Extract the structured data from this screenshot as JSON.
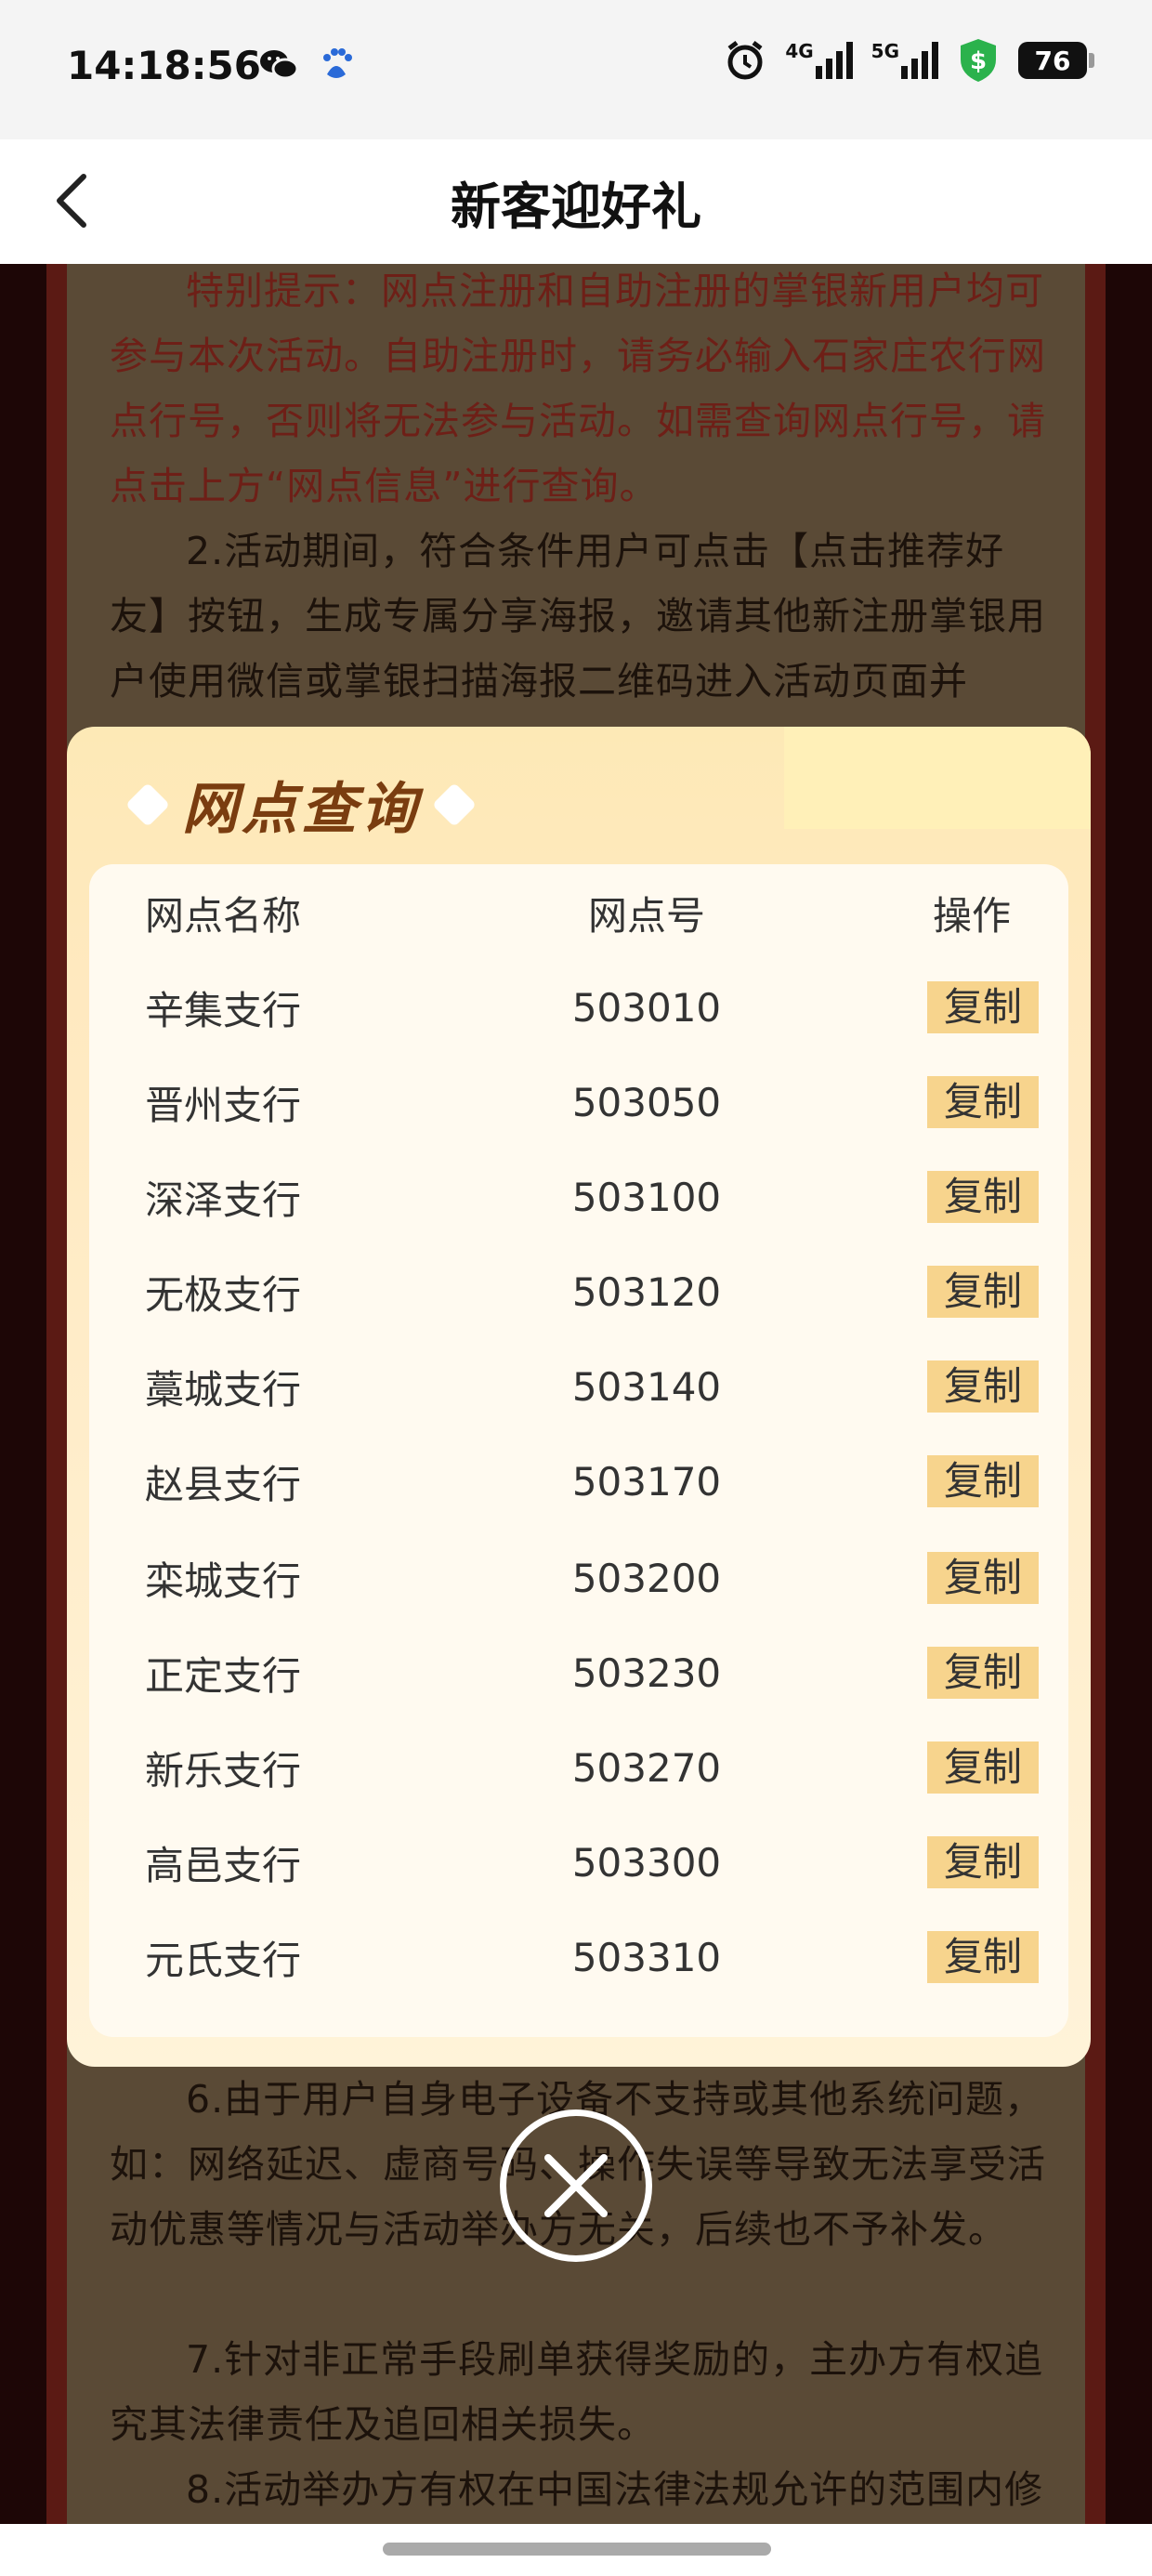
{
  "status_bar": {
    "time": "14:18:56",
    "left_icons": [
      "wechat-icon",
      "baidu-icon"
    ],
    "net_labels": [
      "4G",
      "5G"
    ],
    "battery": "76",
    "colors": {
      "shield": "#2bb24c"
    }
  },
  "header": {
    "title": "新客迎好礼",
    "back_icon": "chevron-left-icon"
  },
  "article": {
    "notice": "特别提示：网点注册和自助注册的掌银新用户均可参与本次活动。自助注册时，请务必输入石家庄农行网点行号，否则将无法参与活动。如需查询网点行号，请点击上方“网点信息”进行查询。",
    "para2": "2.活动期间，符合条件用户可点击【点击推荐好友】按钮，生成专属分享海报，邀请其他新注册掌银用户使用微信或掌银扫描海报二维码进入活动页面并",
    "para6": "6.由于用户自身电子设备不支持或其他系统问题，如：网络延迟、虚商号码、操作失误等导致无法享受活动优惠等情况与活动举办方无关，后续也不予补发。",
    "para7": "7.针对非正常手段刷单获得奖励的，主办方有权追究其法律责任及追回相关损失。",
    "para8": "8.活动举办方有权在中国法律法规允许的范围内修"
  },
  "modal": {
    "title": "网点查询",
    "headers": {
      "name": "网点名称",
      "code": "网点号",
      "op": "操作"
    },
    "rows": [
      {
        "name": "辛集支行",
        "code": "503010",
        "op": "复制"
      },
      {
        "name": "晋州支行",
        "code": "503050",
        "op": "复制"
      },
      {
        "name": "深泽支行",
        "code": "503100",
        "op": "复制"
      },
      {
        "name": "无极支行",
        "code": "503120",
        "op": "复制"
      },
      {
        "name": "藁城支行",
        "code": "503140",
        "op": "复制"
      },
      {
        "name": "赵县支行",
        "code": "503170",
        "op": "复制"
      },
      {
        "name": "栾城支行",
        "code": "503200",
        "op": "复制"
      },
      {
        "name": "正定支行",
        "code": "503230",
        "op": "复制"
      },
      {
        "name": "新乐支行",
        "code": "503270",
        "op": "复制"
      },
      {
        "name": "高邑支行",
        "code": "503300",
        "op": "复制"
      },
      {
        "name": "元氏支行",
        "code": "503310",
        "op": "复制"
      }
    ],
    "close_icon": "close-circle-icon",
    "colors": {
      "copy_bg": "#f7d48d",
      "title": "#7a3d10"
    }
  }
}
